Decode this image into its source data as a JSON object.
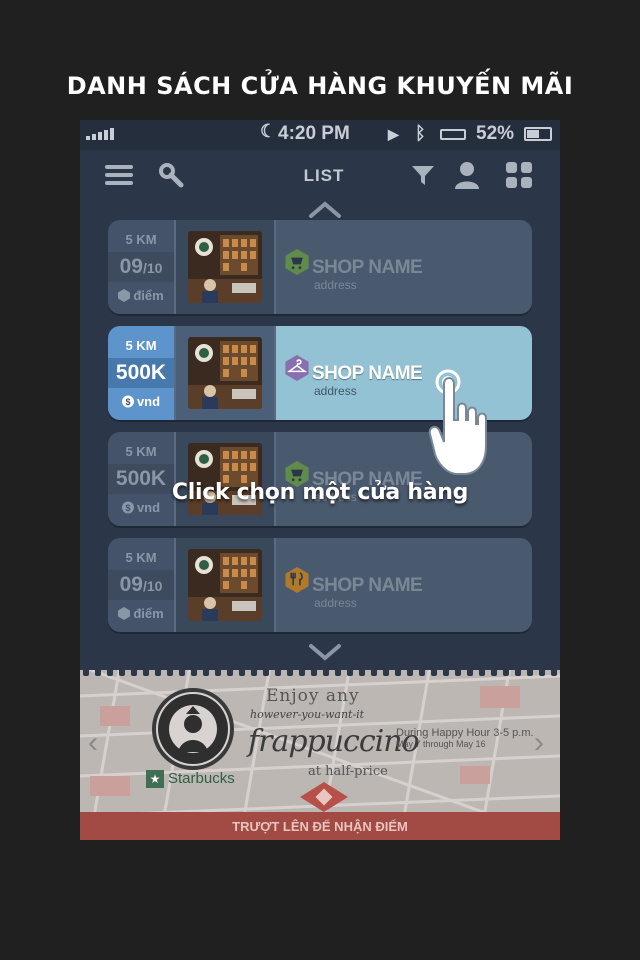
{
  "heading": "DANH SÁCH CỬA HÀNG KHUYẾN MÃI",
  "status_bar": {
    "time": "4:20 PM",
    "battery": "52%"
  },
  "nav": {
    "title": "LIST"
  },
  "stores": [
    {
      "distance": "5 KM",
      "value_main": "09",
      "value_suffix": "/10",
      "unit": "điểm",
      "unit_icon": "hexagon-icon",
      "category_icon": "cart-icon",
      "icon_color": "#5f8c4a",
      "name": "SHOP NAME",
      "address": "address",
      "active": false
    },
    {
      "distance": "5 KM",
      "value_main": "500K",
      "value_suffix": "",
      "unit": "vnd",
      "unit_icon": "dollar-icon",
      "category_icon": "hanger-icon",
      "icon_color": "#8a6fb0",
      "name": "SHOP NAME",
      "address": "address",
      "active": true
    },
    {
      "distance": "5 KM",
      "value_main": "500K",
      "value_suffix": "",
      "unit": "vnd",
      "unit_icon": "dollar-icon",
      "category_icon": "cart-icon",
      "icon_color": "#5f8c4a",
      "name": "SHOP NAME",
      "address": "address",
      "active": false
    },
    {
      "distance": "5 KM",
      "value_main": "09",
      "value_suffix": "/10",
      "unit": "điểm",
      "unit_icon": "hexagon-icon",
      "category_icon": "fork-knife-icon",
      "icon_color": "#b07a2a",
      "name": "SHOP NAME",
      "address": "address",
      "active": false
    }
  ],
  "hint": "Click chọn một cửa hàng",
  "banner": {
    "line1": "Enjoy any",
    "line2": "however-you-want-it",
    "line3": "frappuccino",
    "line4": "at half-price",
    "details_line1": "During Happy Hour 3-5 p.m.",
    "details_line2": "May 7 through May 16",
    "brand": "Starbucks",
    "footer": "TRƯỢT LÊN ĐỂ NHẬN ĐIỂM"
  },
  "colors": {
    "background": "#202020",
    "panel": "#2b3748",
    "active_blue": "#5e94cc",
    "active_card": "#92c2d3",
    "footer_red": "#a24b45"
  }
}
